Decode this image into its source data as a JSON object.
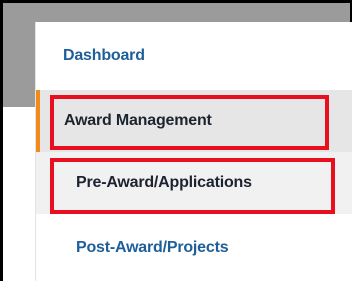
{
  "sidebar": {
    "items": [
      {
        "label": "Dashboard"
      },
      {
        "label": "Award Management"
      },
      {
        "label": "Pre-Award/Applications"
      },
      {
        "label": "Post-Award/Projects"
      }
    ]
  },
  "colors": {
    "link": "#1f5f99",
    "active_text": "#1d2430",
    "active_indicator": "#f08a1c",
    "highlight": "#e8101e",
    "header_gray": "#9b9b9b"
  }
}
